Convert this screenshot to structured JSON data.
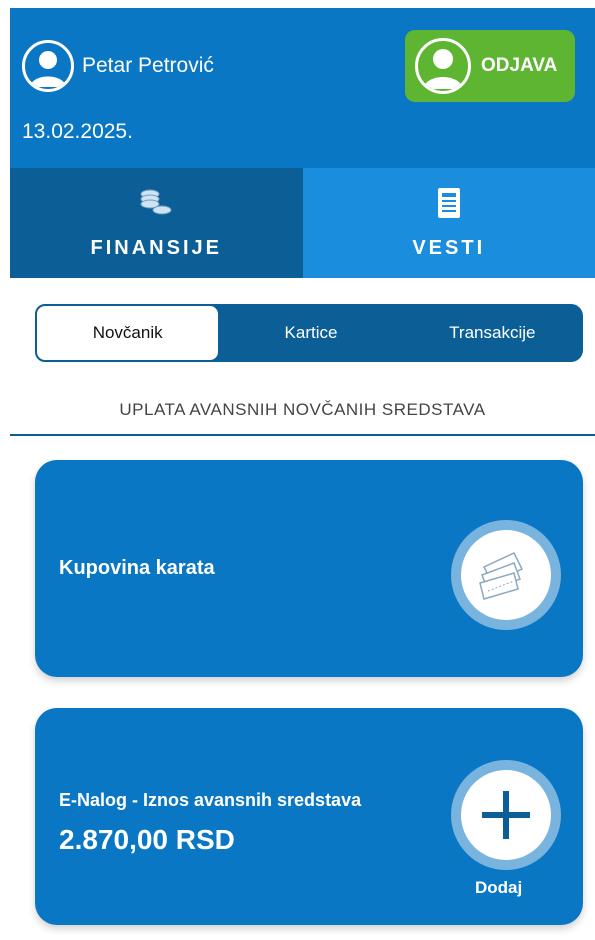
{
  "header": {
    "user_name": "Petar Petrović",
    "date": "13.02.2025.",
    "logout_label": "ODJAVA"
  },
  "tabs": [
    {
      "label": "FINANSIJE",
      "icon": "coins-icon",
      "active": true
    },
    {
      "label": "VESTI",
      "icon": "newspaper-icon",
      "active": false
    }
  ],
  "segments": [
    {
      "label": "Novčanik",
      "active": true
    },
    {
      "label": "Kartice",
      "active": false
    },
    {
      "label": "Transakcije",
      "active": false
    }
  ],
  "section_title": "UPLATA AVANSNIH NOVČANIH SREDSTAVA",
  "cards": {
    "tickets": {
      "title": "Kupovina karata",
      "icon": "tickets-icon"
    },
    "enalog": {
      "title": "E-Nalog - Iznos avansnih sredstava",
      "amount": "2.870,00 RSD",
      "action_label": "Dodaj",
      "icon": "plus-icon"
    }
  },
  "colors": {
    "primary": "#0a77c4",
    "dark": "#0b5f96",
    "light_tab": "#1a8ddd",
    "green": "#5db531"
  }
}
